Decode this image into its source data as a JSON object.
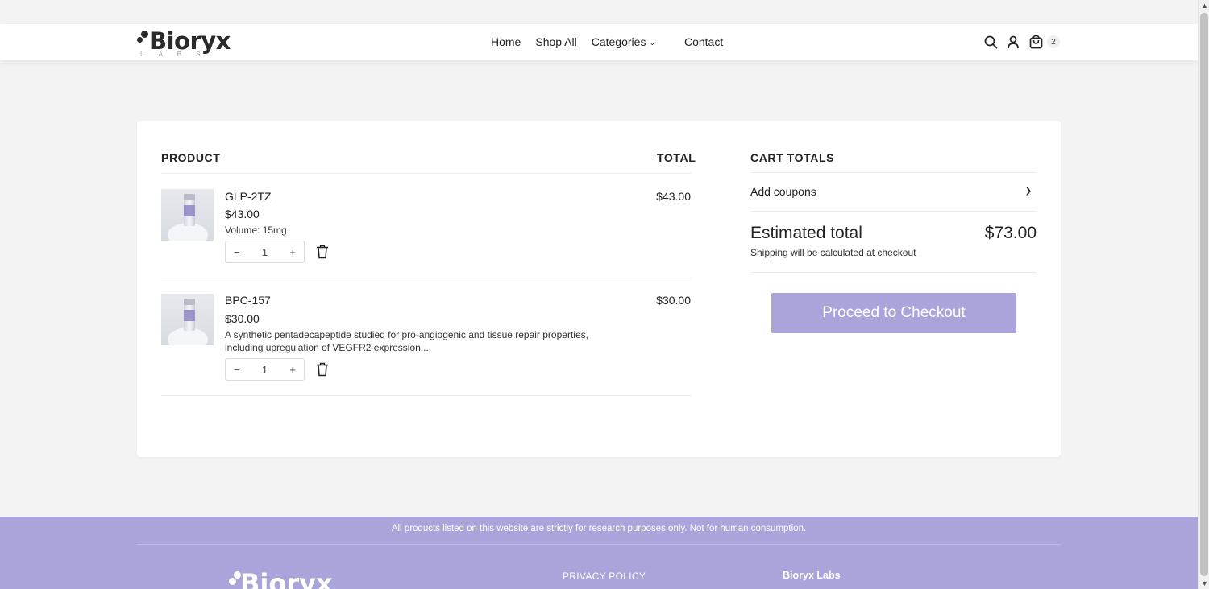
{
  "header": {
    "logo_text": "Bioryx",
    "logo_sub": "LABS",
    "nav": [
      "Home",
      "Shop All",
      "Categories",
      "Contact"
    ],
    "cart_count": "2"
  },
  "cart": {
    "col_product": "PRODUCT",
    "col_total": "TOTAL",
    "items": [
      {
        "name": "GLP-2TZ",
        "price": "$43.00",
        "meta": "Volume: 15mg",
        "quantity": "1",
        "total": "$43.00"
      },
      {
        "name": "BPC-157",
        "price": "$30.00",
        "meta": "A synthetic pentadecapeptide studied for pro-angiogenic and tissue repair properties, including upregulation of VEGFR2 expression...",
        "quantity": "1",
        "total": "$30.00"
      }
    ],
    "stepper_minus": "−",
    "stepper_plus": "+"
  },
  "totals": {
    "title": "CART TOTALS",
    "add_coupons": "Add coupons",
    "estimated_label": "Estimated total",
    "estimated_value": "$73.00",
    "shipping_note": "Shipping will be calculated at checkout",
    "checkout_label": "Proceed to Checkout"
  },
  "footer": {
    "notice": "All products listed on this website are strictly for research purposes only. Not for human consumption.",
    "privacy": "PRIVACY POLICY",
    "brand": "Bioryx Labs",
    "logo_text": "Bioryx"
  },
  "colors": {
    "accent": "#aaa4db",
    "footer_bg": "#a9a4d9"
  }
}
